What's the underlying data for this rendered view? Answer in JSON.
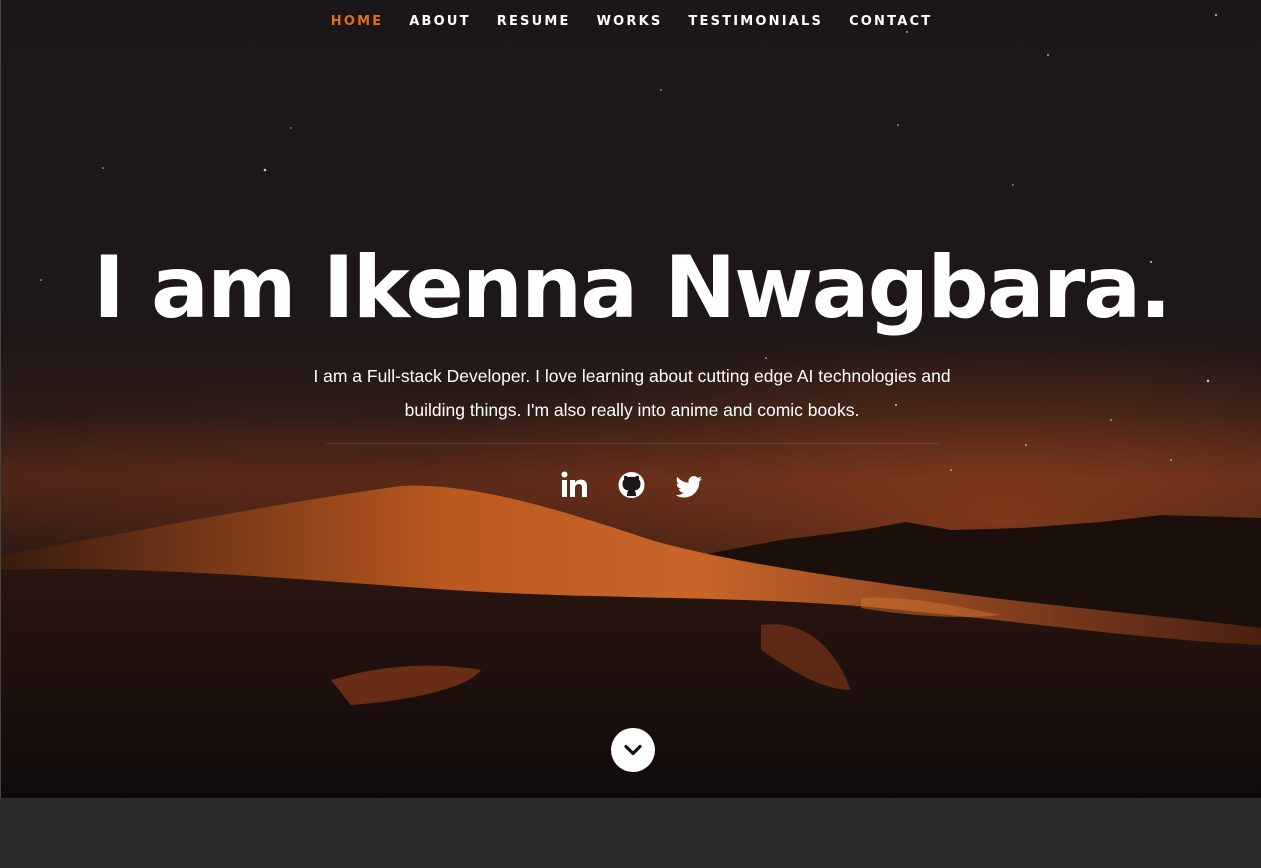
{
  "nav": {
    "items": [
      {
        "label": "HOME",
        "active": true
      },
      {
        "label": "ABOUT",
        "active": false
      },
      {
        "label": "RESUME",
        "active": false
      },
      {
        "label": "WORKS",
        "active": false
      },
      {
        "label": "TESTIMONIALS",
        "active": false
      },
      {
        "label": "CONTACT",
        "active": false
      }
    ],
    "active_color": "#e46b1b"
  },
  "hero": {
    "headline": "I am Ikenna Nwagbara.",
    "bio": "I am a Full-stack Developer. I love learning about cutting edge AI technologies and building things. I'm also really into anime and comic books."
  },
  "social": [
    {
      "name": "linkedin-icon"
    },
    {
      "name": "github-icon"
    },
    {
      "name": "twitter-icon"
    }
  ],
  "scroll_icon": "chevron-down-icon"
}
